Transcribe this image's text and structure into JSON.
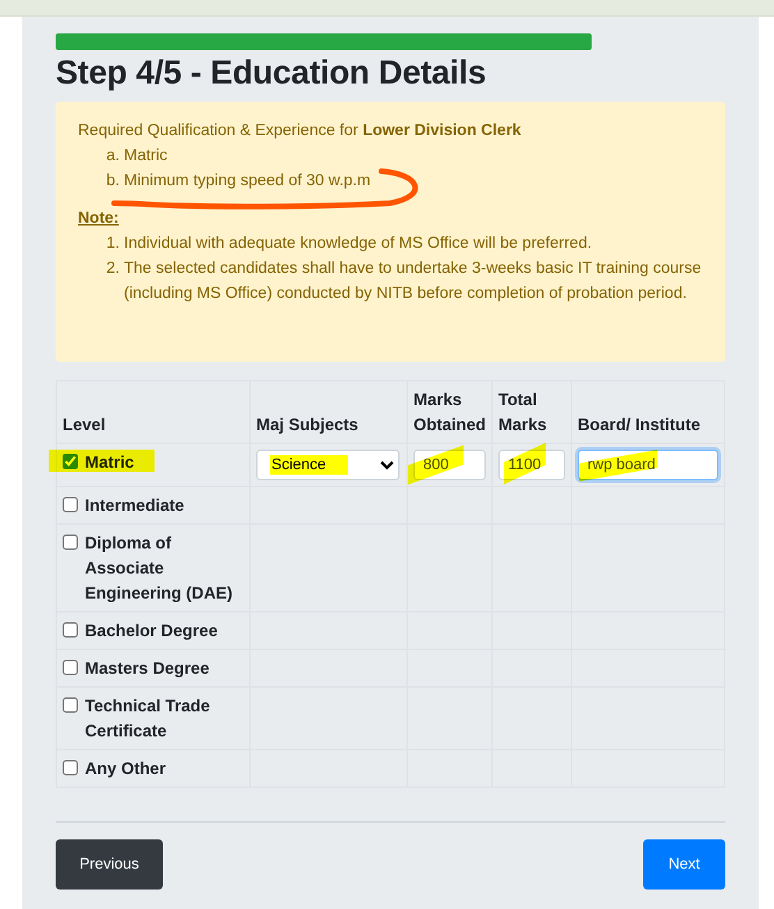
{
  "title": "Step 4/5 - Education Details",
  "requirements": {
    "intro": "Required Qualification & Experience for **Lower Division Clerk**",
    "items": [
      {
        "marker": "a.",
        "text": "Matric"
      },
      {
        "marker": "b.",
        "text": "Minimum typing speed of 30 w.p.m"
      }
    ],
    "note_label": "Note:",
    "notes": [
      {
        "marker": "1.",
        "text": "Individual with adequate knowledge of MS Office will be preferred."
      },
      {
        "marker": "2.",
        "text": "The selected candidates shall have to undertake 3-weeks basic IT training course (including MS Office) conducted by NITB before completion of probation period."
      }
    ]
  },
  "table": {
    "columns": [
      "Level",
      "Maj Subjects",
      "Marks Obtained",
      "Total Marks",
      "Board/ Institute"
    ],
    "rows": [
      {
        "level": "Matric",
        "checked": true,
        "subject": "Science",
        "marks_obtained": "800",
        "total_marks": "1100",
        "board": "rwp board"
      },
      {
        "level": "Intermediate",
        "checked": false
      },
      {
        "level": "Diploma of Associate Engineering (DAE)",
        "checked": false
      },
      {
        "level": "Bachelor Degree",
        "checked": false
      },
      {
        "level": "Masters Degree",
        "checked": false
      },
      {
        "level": "Technical Trade Certificate",
        "checked": false
      },
      {
        "level": "Any Other",
        "checked": false
      }
    ]
  },
  "buttons": {
    "previous": "Previous",
    "next": "Next"
  }
}
